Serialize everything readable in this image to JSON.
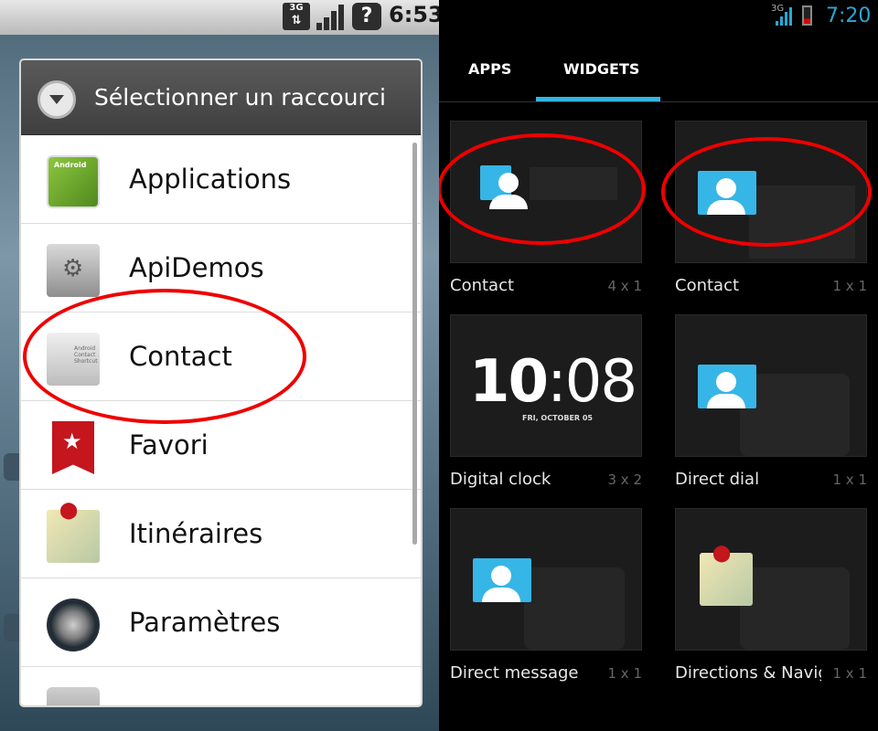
{
  "left": {
    "status": {
      "network": "3G",
      "time": "6:53",
      "help_icon": "?"
    },
    "dialog": {
      "title": "Sélectionner un raccourci",
      "items": [
        {
          "label": "Applications",
          "icon": "android-apps-icon"
        },
        {
          "label": "ApiDemos",
          "icon": "folder-gear-icon"
        },
        {
          "label": "Contact",
          "icon": "android-contact-shortcut-icon"
        },
        {
          "label": "Favori",
          "icon": "bookmark-star-icon"
        },
        {
          "label": "Itinéraires",
          "icon": "directions-map-icon"
        },
        {
          "label": "Paramètres",
          "icon": "settings-icon"
        },
        {
          "label": "",
          "icon": "playlist-icon"
        }
      ]
    },
    "highlight_color": "#e00000"
  },
  "right": {
    "status": {
      "network": "3G",
      "time": "7:20"
    },
    "tabs": [
      {
        "label": "APPS"
      },
      {
        "label": "WIDGETS",
        "selected": true
      }
    ],
    "widgets": [
      {
        "name": "Contact",
        "span": "4 x 1"
      },
      {
        "name": "Contact",
        "span": "1 x 1"
      },
      {
        "name": "Digital clock",
        "span": "3 x 2",
        "preview_time_hours": "10",
        "preview_time_minutes": "08",
        "preview_date": "FRI, OCTOBER 05"
      },
      {
        "name": "Direct dial",
        "span": "1 x 1"
      },
      {
        "name": "Direct message",
        "span": "1 x 1"
      },
      {
        "name": "Directions & Navig",
        "span": "1 x 1"
      }
    ],
    "accent_color": "#33b5e5"
  }
}
